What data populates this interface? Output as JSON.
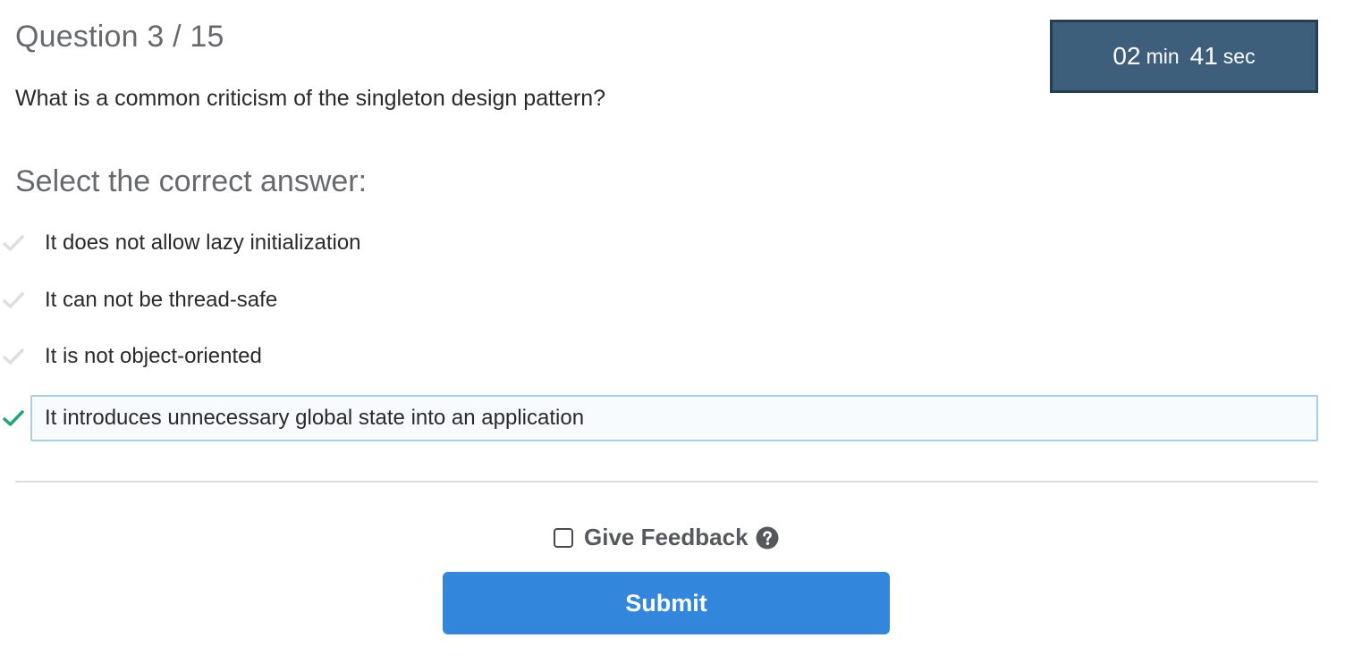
{
  "header": {
    "question_label": "Question 3 / 15"
  },
  "timer": {
    "minutes": "02",
    "minutes_unit": "min",
    "seconds": "41",
    "seconds_unit": "sec"
  },
  "question": {
    "text": "What is a common criticism of the singleton design pattern?"
  },
  "answer_prompt": "Select the correct answer:",
  "options": [
    {
      "label": "It does not allow lazy initialization",
      "selected": false
    },
    {
      "label": "It can not be thread-safe",
      "selected": false
    },
    {
      "label": "It is not object-oriented",
      "selected": false
    },
    {
      "label": "It introduces unnecessary global state into an application",
      "selected": true
    }
  ],
  "feedback": {
    "label": "Give Feedback",
    "checked": false,
    "help_icon": "question-circle-icon"
  },
  "submit": {
    "label": "Submit"
  },
  "colors": {
    "timer_bg": "#3e5f7c",
    "timer_border": "#263d52",
    "submit_bg": "#3286dc",
    "check_active": "#1fa672",
    "check_inactive": "#dedede",
    "selected_border": "#a9cfe6"
  }
}
